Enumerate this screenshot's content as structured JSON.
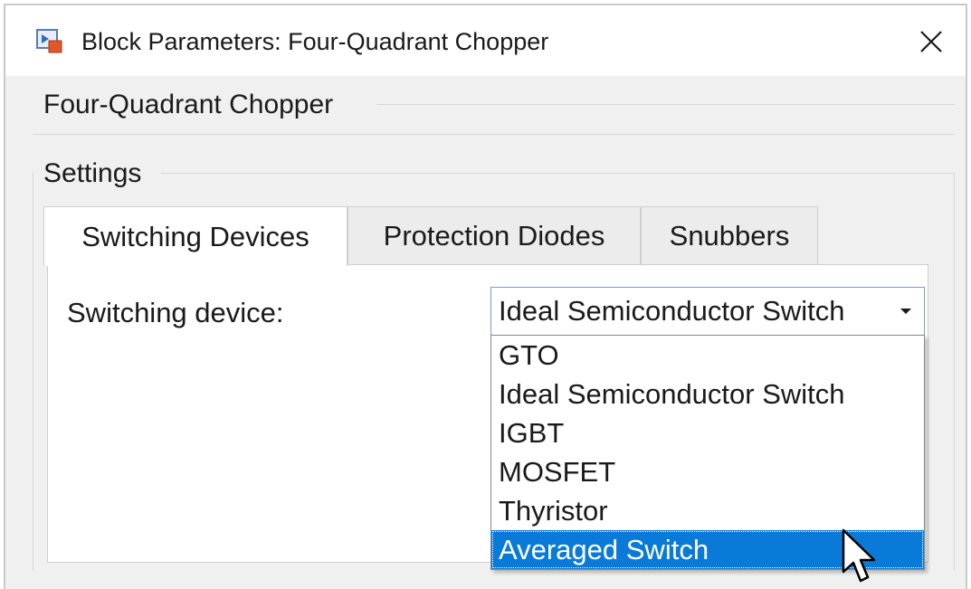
{
  "window": {
    "title": "Block Parameters: Four-Quadrant Chopper",
    "close_glyph": "✕"
  },
  "block": {
    "name": "Four-Quadrant Chopper"
  },
  "settings": {
    "label": "Settings"
  },
  "tabs": [
    {
      "label": "Switching Devices",
      "active": true
    },
    {
      "label": "Protection Diodes",
      "active": false
    },
    {
      "label": "Snubbers",
      "active": false
    }
  ],
  "switching_device": {
    "label": "Switching device:",
    "value": "Ideal Semiconductor Switch",
    "options": [
      "GTO",
      "Ideal Semiconductor Switch",
      "IGBT",
      "MOSFET",
      "Thyristor",
      "Averaged Switch"
    ],
    "highlighted": "Averaged Switch"
  },
  "colors": {
    "highlight": "#0a7ad8",
    "combo_border": "#7a9cc6",
    "background": "#f0f0f0"
  },
  "icons": {
    "app": "simulink-block-icon",
    "close": "close-icon",
    "dropdown": "chevron-down-icon",
    "cursor": "mouse-pointer-icon"
  }
}
